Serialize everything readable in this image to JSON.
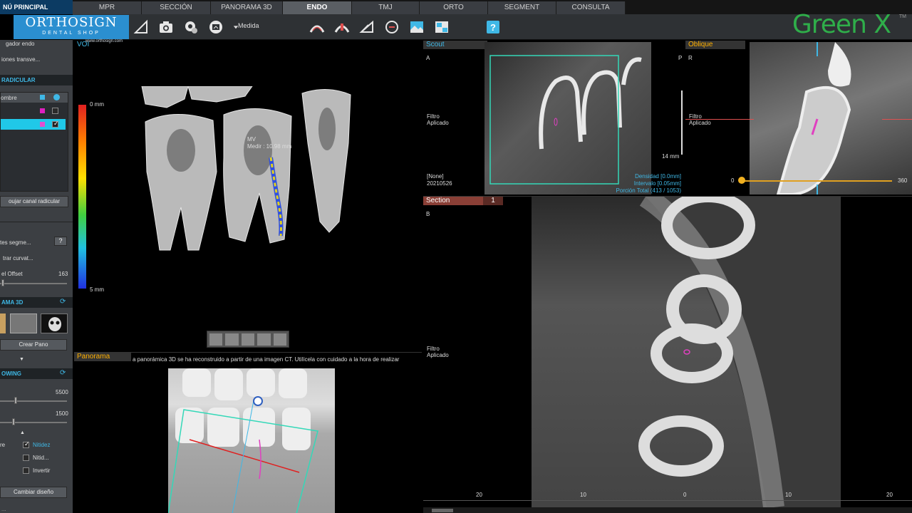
{
  "menu_title": "NÚ PRINCIPAL",
  "tabs": [
    {
      "label": "MPR",
      "active": false
    },
    {
      "label": "SECCIÓN",
      "active": false
    },
    {
      "label": "PANORAMA 3D",
      "active": false
    },
    {
      "label": "ENDO",
      "active": true
    },
    {
      "label": "TMJ",
      "active": false
    },
    {
      "label": "ORTO",
      "active": false
    },
    {
      "label": "SEGMENT",
      "active": false
    },
    {
      "label": "CONSULTA",
      "active": false
    }
  ],
  "toolbar": {
    "medida_label": "Medida",
    "brand": "Green X",
    "brand_color": "#2fae4a",
    "trademark": "TM",
    "icons": [
      "angle-measure-icon",
      "camera-icon",
      "capture-settings-icon",
      "image-export-icon",
      "dropdown-arrow-icon",
      "nerve-canal-icon",
      "implant-icon",
      "angle-tool-icon",
      "circle-tool-icon",
      "image-adjust-icon",
      "layout-icon",
      "help-icon"
    ]
  },
  "logo": {
    "line1": "ORTHOSIGN",
    "line2": "DENTAL SHOP",
    "url": "www.orthosign.com"
  },
  "sidebar": {
    "item1": "gador endo",
    "item2": "iones transve...",
    "section_radicular": "RADICULAR",
    "table_header": "ombre",
    "draw_button": "oujar canal radicular",
    "segments_label": "tes segme...",
    "help": "?",
    "curvature_label": "trar curvat...",
    "offset_label": "el Offset",
    "offset_value": "163",
    "section_panorama": "AMA 3D",
    "crear_pano": "Crear Pano",
    "section_viewing": "OWING",
    "slider1_value": "5500",
    "slider2_value": "1500",
    "opt_prefix": "re",
    "nitidez_label": "Nitidez",
    "nitid_label": "Nitid...",
    "invertir_label": "Invertir",
    "cambiar_diseno": "Cambiar diseño",
    "bottom_text": "..."
  },
  "viewports": {
    "voi": {
      "title": "VOI",
      "scale_top": "0 mm",
      "scale_bottom": "5 mm",
      "measure_name": "MV",
      "measure_value": "Medir : 10.98 mm"
    },
    "panorama": {
      "title": "Panorama",
      "notice": "a panorámica 3D se ha reconstruido a partir de una imagen CT. Utilícela con cuidado a la hora de realizar"
    },
    "scout": {
      "title": "Scout",
      "orient_left": "A",
      "orient_right": "P",
      "filter": "Filtro\nAplicado",
      "none": "[None]",
      "date": "20210526",
      "scale": "14 mm",
      "densidad": "Densidad [0.0mm]",
      "intervalo": "Intervalo [0.05mm]",
      "porcion": "Porción Total (413 / 1053)"
    },
    "oblique": {
      "title": "Oblique",
      "orient": "R",
      "filter": "Filtro\nAplicado",
      "slider_min": "0",
      "slider_max": "360",
      "slider_value": 0
    },
    "section": {
      "title": "Section",
      "index": "1",
      "orient": "B",
      "filter": "Filtro\nAplicado",
      "ruler": [
        "20",
        "10",
        "0",
        "10",
        "20"
      ]
    }
  }
}
